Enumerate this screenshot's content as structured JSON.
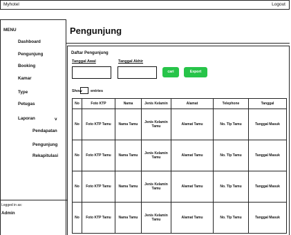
{
  "app": {
    "title": "Myhotel",
    "logout_label": "Logout"
  },
  "sidebar": {
    "menu_title": "MENU",
    "items": [
      {
        "label": "Dashboard"
      },
      {
        "label": "Pengunjung"
      },
      {
        "label": "Booking"
      },
      {
        "label": "Kamar"
      },
      {
        "label": "Type"
      },
      {
        "label": "Petugas"
      },
      {
        "label": "Laporan"
      }
    ],
    "laporan_chevron": "v",
    "sub_items": [
      {
        "label": "Pendapatan"
      },
      {
        "label": "Pengunjung"
      },
      {
        "label": "Rekapitulasi"
      }
    ],
    "logged_in_label": "Logged in as:",
    "user": "Admin"
  },
  "page": {
    "title": "Pengunjung"
  },
  "filter": {
    "section_title": "Daftar Pengunjung",
    "start_label": "Tanggal Awal",
    "end_label": "Tanggal Akhir",
    "start_value": "",
    "end_value": "",
    "search_button": "cari",
    "export_button": "Export",
    "button_color": "#27c449"
  },
  "table_controls": {
    "show_label": "Show",
    "entries_label": "entries"
  },
  "table": {
    "headers": [
      "No",
      "Foto KTP",
      "Nama",
      "Jenis Kelamin",
      "Alamat",
      "Telephone",
      "Tanggal"
    ],
    "rows": [
      [
        "No",
        "Foto KTP Tamu",
        "Nama Tamu",
        "Jenis Kelamin Tamu",
        "Alamat Tamu",
        "No. Tlp Tamu",
        "Tanggal Masuk"
      ],
      [
        "No",
        "Foto KTP Tamu",
        "Nama Tamu",
        "Jenis Kelamin Tamu",
        "Alamat Tamu",
        "No. Tlp Tamu",
        "Tanggal Masuk"
      ],
      [
        "No",
        "Foto KTP Tamu",
        "Nama Tamu",
        "Jenis Kelamin Tamu",
        "Alamat Tamu",
        "No. Tlp Tamu",
        "Tanggal Masuk"
      ],
      [
        "No",
        "Foto KTP Tamu",
        "Nama Tamu",
        "Jenis Kelamin Tamu",
        "Alamat Tamu",
        "No. Tlp Tamu",
        "Tanggal Masuk"
      ]
    ]
  }
}
